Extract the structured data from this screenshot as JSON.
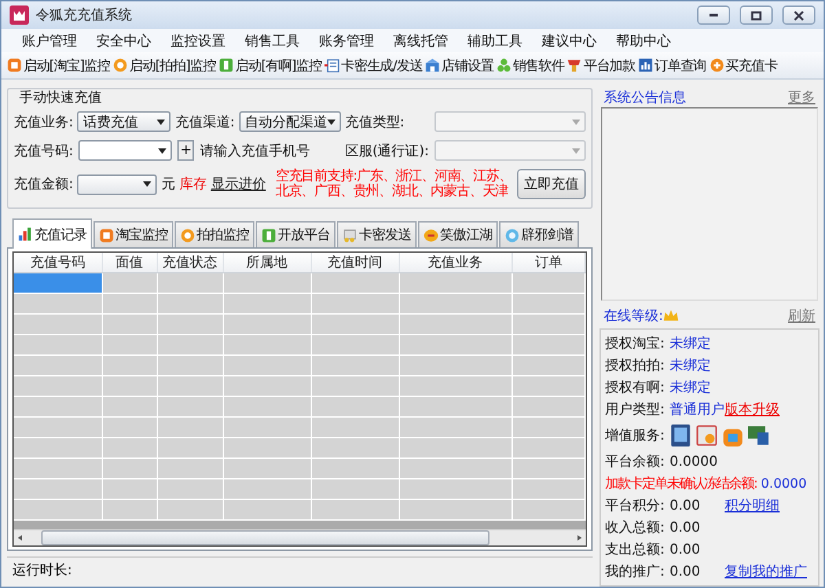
{
  "window": {
    "title": "令狐充充值系统"
  },
  "menu": [
    "账户管理",
    "安全中心",
    "监控设置",
    "销售工具",
    "账务管理",
    "离线托管",
    "辅助工具",
    "建议中心",
    "帮助中心"
  ],
  "toolbar": [
    "启动[淘宝]监控",
    "启动[拍拍]监控",
    "启动[有啊]监控",
    "卡密生成/发送",
    "店铺设置",
    "销售软件",
    "平台加款",
    "订单查询",
    "买充值卡"
  ],
  "form": {
    "title": "手动快速充值",
    "business": {
      "label": "充值业务:",
      "value": "话费充值",
      "disabled": false
    },
    "channel": {
      "label": "充值渠道:",
      "value": "自动分配渠道",
      "disabled": false
    },
    "type": {
      "label": "充值类型:",
      "disabled": true
    },
    "number": {
      "label": "充值号码:",
      "add": "+",
      "hint": "请输入充值手机号",
      "disabled": false
    },
    "server": {
      "label": "区服(通行证):",
      "disabled": true
    },
    "amount": {
      "label": "充值金额:",
      "unit": "元",
      "stock": "库存",
      "show_price": "显示进价",
      "disabled": false
    },
    "notice_lines": [
      "空充目前支持:广东、浙江、河南、江苏、",
      "北京、广西、贵州、湖北、内蒙古、天津"
    ],
    "submit": "立即充值"
  },
  "tabs": [
    {
      "label": "充值记录",
      "selected": true
    },
    {
      "label": "淘宝监控",
      "selected": false
    },
    {
      "label": "拍拍监控",
      "selected": false
    },
    {
      "label": "开放平台",
      "selected": false
    },
    {
      "label": "卡密发送",
      "selected": false
    },
    {
      "label": "笑傲江湖",
      "selected": false
    },
    {
      "label": "辟邪剑谱",
      "selected": false
    }
  ],
  "table": {
    "columns": [
      "充值号码",
      "面值",
      "充值状态",
      "所属地",
      "充值时间",
      "充值业务",
      "订单"
    ],
    "rows": [
      {
        "selected": true
      },
      {
        "selected": false
      },
      {
        "selected": false
      },
      {
        "selected": false
      },
      {
        "selected": false
      },
      {
        "selected": false
      },
      {
        "selected": false
      },
      {
        "selected": false
      },
      {
        "selected": false
      },
      {
        "selected": false
      },
      {
        "selected": false
      },
      {
        "selected": false
      }
    ]
  },
  "notice": {
    "title": "系统公告信息",
    "more": "更多"
  },
  "account": {
    "level_label": "在线等级:",
    "refresh": "刷新",
    "rows": [
      {
        "kind": "status",
        "label": "授权淘宝:",
        "value": "未绑定"
      },
      {
        "kind": "status",
        "label": "授权拍拍:",
        "value": "未绑定"
      },
      {
        "kind": "status",
        "label": "授权有啊:",
        "value": "未绑定"
      },
      {
        "kind": "status",
        "label": "用户类型:",
        "value": "普通用户",
        "link": "版本升级"
      },
      {
        "kind": "services",
        "label": "增值服务:"
      },
      {
        "kind": "amount",
        "label": "平台余额:",
        "value": "0.0000"
      },
      {
        "kind": "alert",
        "label": "加款卡定单未确认冻结余额:",
        "value": "0.0000"
      },
      {
        "kind": "amount",
        "label": "平台积分:",
        "value": "0.00",
        "link": "积分明细"
      },
      {
        "kind": "amount",
        "label": "收入总额:",
        "value": "0.00"
      },
      {
        "kind": "amount",
        "label": "支出总额:",
        "value": "0.00"
      },
      {
        "kind": "amount",
        "label": "我的推广:",
        "value": "0.00",
        "link": "复制我的推广"
      }
    ]
  },
  "status_bar": {
    "label": "运行时长:"
  }
}
